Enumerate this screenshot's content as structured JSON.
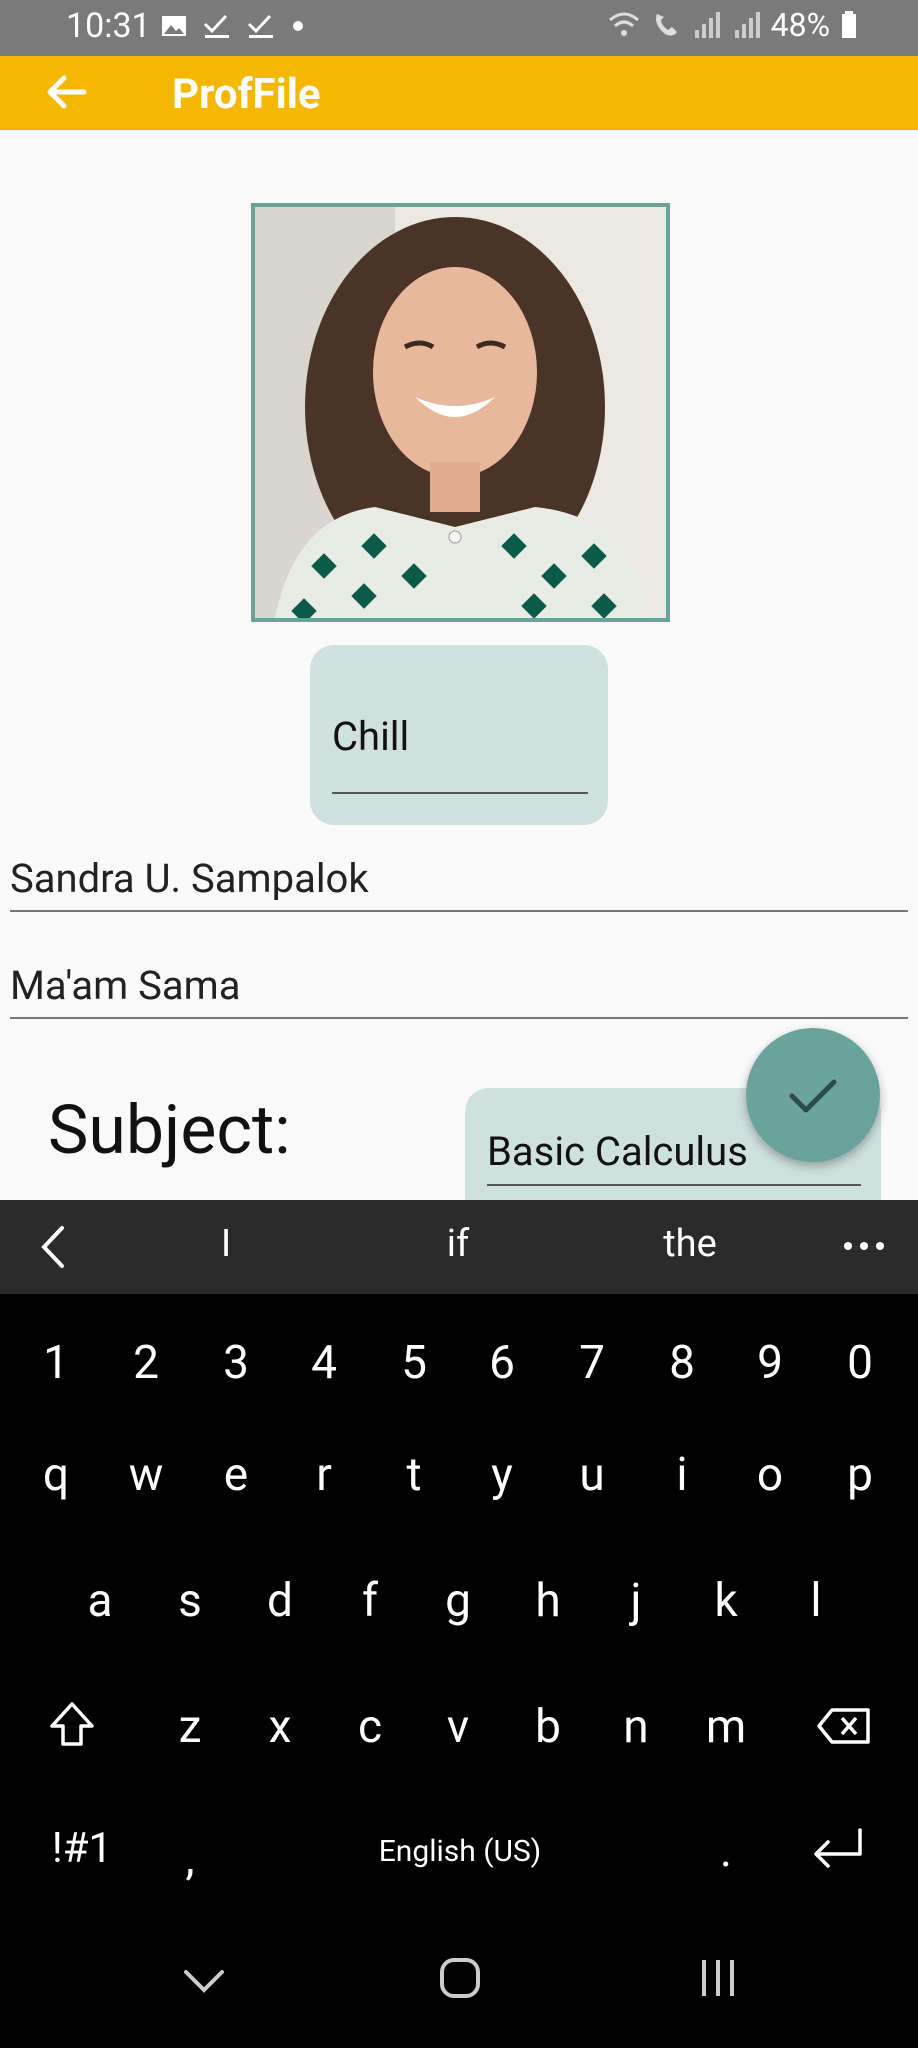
{
  "status_bar": {
    "time": "10:31",
    "battery": "48%"
  },
  "app_bar": {
    "title": "ProfFile"
  },
  "profile": {
    "photo_desc": "profile-photo",
    "status_value": "Chill",
    "name_value": "Sandra U. Sampalok",
    "nickname_value": "Ma'am Sama",
    "subject_label": "Subject:",
    "subject_value": "Basic Calculus"
  },
  "keyboard": {
    "suggestions": [
      "I",
      "if",
      "the"
    ],
    "numbers": [
      "1",
      "2",
      "3",
      "4",
      "5",
      "6",
      "7",
      "8",
      "9",
      "0"
    ],
    "row1": [
      "q",
      "w",
      "e",
      "r",
      "t",
      "y",
      "u",
      "i",
      "o",
      "p"
    ],
    "row2": [
      "a",
      "s",
      "d",
      "f",
      "g",
      "h",
      "j",
      "k",
      "l"
    ],
    "row3": [
      "z",
      "x",
      "c",
      "v",
      "b",
      "n",
      "m"
    ],
    "symbols_key": "!#1",
    "comma_key": ",",
    "space_label": "English (US)",
    "period_key": "."
  },
  "colors": {
    "accent": "#f5b800",
    "teal": "#6aa39c",
    "field_bg": "#cfe1de"
  }
}
